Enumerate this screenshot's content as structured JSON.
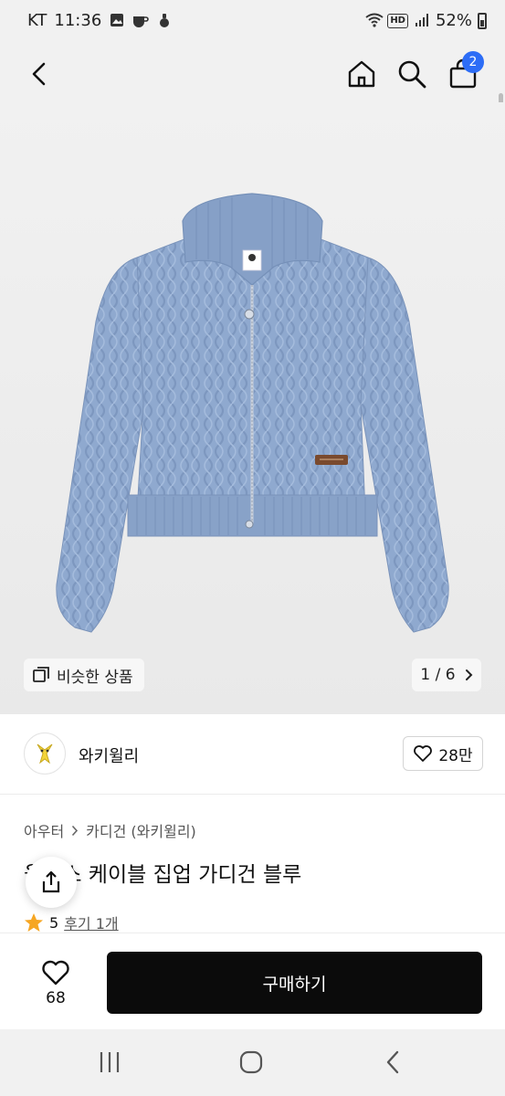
{
  "status_bar": {
    "carrier": "KT",
    "time": "11:36",
    "battery": "52%",
    "icons": [
      "gallery-icon",
      "coffee-icon",
      "android-icon",
      "wifi-icon",
      "hd-icon",
      "signal-icon",
      "battery-icon"
    ],
    "hd_label": "HD"
  },
  "top_nav": {
    "icons": [
      "back-icon",
      "home-icon",
      "search-icon",
      "cart-icon"
    ],
    "cart_count": "2",
    "accent_color": "#2d6df6"
  },
  "gallery": {
    "similar_label": "비슷한 상품",
    "pager": "1 / 6",
    "current_page": 1,
    "total_pages": 6,
    "product_color": "#8fa9cf"
  },
  "brand": {
    "name": "와키윌리",
    "likes": "28만"
  },
  "breadcrumb": {
    "category": "아우터",
    "subcategory": "카디건 (와키윌리)"
  },
  "product": {
    "title": "울리스 케이블 집업 가디건 블루",
    "rating": "5",
    "reviews": "후기 1개"
  },
  "bottom_bar": {
    "wish_count": "68",
    "buy_label": "구매하기"
  },
  "system_nav": {
    "icons": [
      "recent-apps-icon",
      "home-circle-icon",
      "back-nav-icon"
    ]
  }
}
